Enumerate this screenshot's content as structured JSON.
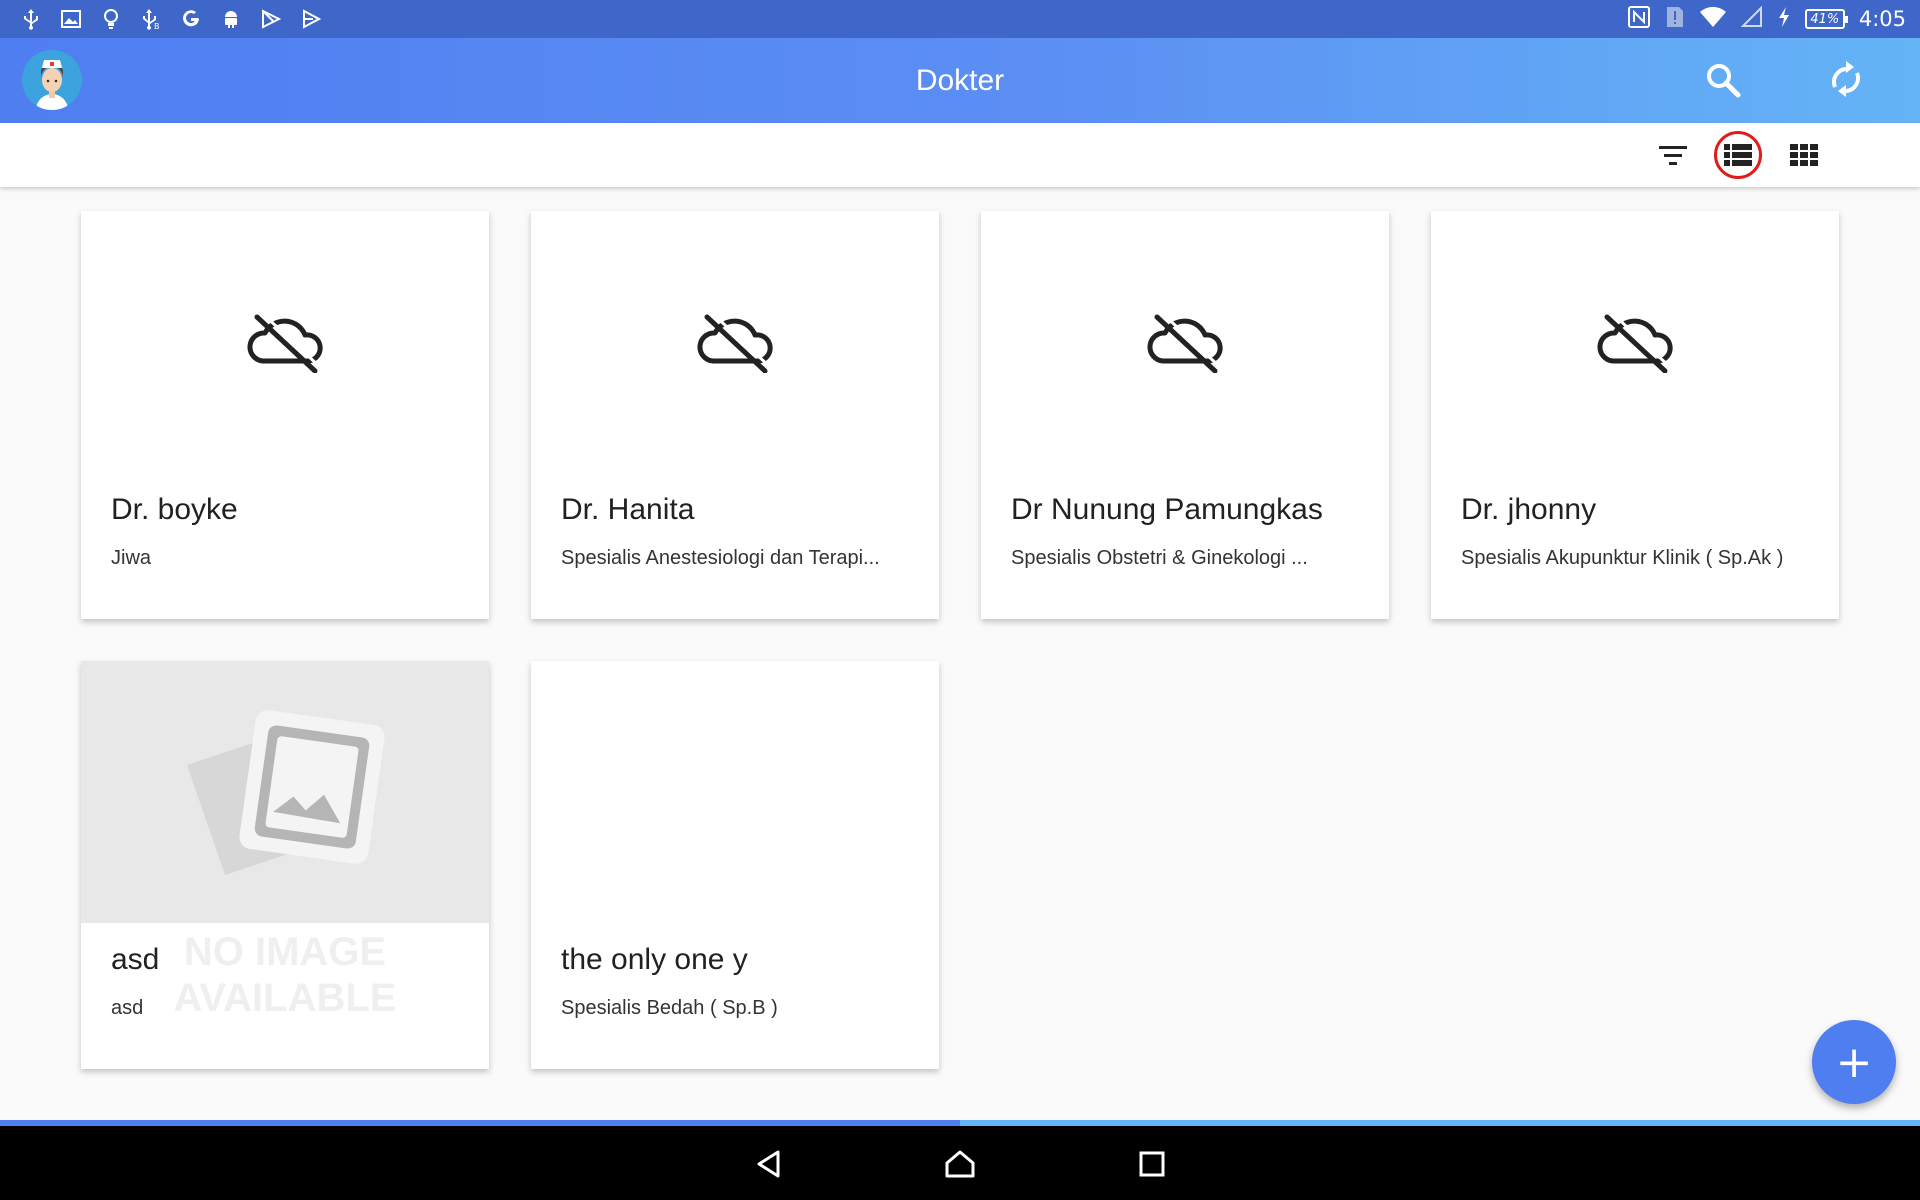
{
  "status_bar": {
    "icons": [
      "usb-icon",
      "image-icon",
      "bulb-icon",
      "usb-debug-icon",
      "google-icon",
      "android-icon",
      "play-store-icon",
      "play-icon"
    ],
    "right_icons": [
      "nfc-icon",
      "sim-alert-icon",
      "wifi-icon",
      "signal-icon",
      "charging-icon"
    ],
    "battery": "41%",
    "time": "4:05"
  },
  "app_bar": {
    "title": "Dokter",
    "actions": [
      "search-icon",
      "sync-icon"
    ]
  },
  "toolbar": {
    "buttons": [
      "filter-icon",
      "list-view-icon",
      "grid-view-icon"
    ],
    "selected": "list-view-icon"
  },
  "cards": [
    {
      "name": "Dr. boyke",
      "specialty": "Jiwa",
      "image": "cloud-off-icon"
    },
    {
      "name": "Dr. Hanita",
      "specialty": "Spesialis Anestesiologi dan Terapi...",
      "image": "cloud-off-icon"
    },
    {
      "name": "Dr Nunung Pamungkas",
      "specialty": "Spesialis Obstetri & Ginekologi ...",
      "image": "cloud-off-icon"
    },
    {
      "name": "Dr. jhonny",
      "specialty": "Spesialis Akupunktur Klinik ( Sp.Ak )",
      "image": "cloud-off-icon"
    },
    {
      "name": "asd",
      "specialty": "asd",
      "image": "no-image-placeholder",
      "placeholder_text": "NO IMAGE AVAILABLE"
    },
    {
      "name": "the only one y",
      "specialty": "Spesialis Bedah ( Sp.B )",
      "image": ""
    }
  ],
  "fab": {
    "label": "+"
  },
  "progress": {
    "fraction": 0.5
  },
  "colors": {
    "status_bar": "#3f67c9",
    "app_bar_start": "#4f7ef1",
    "app_bar_end": "#64b4f6",
    "accent": "#4f7ef1",
    "selection_ring": "#e01b1b"
  }
}
